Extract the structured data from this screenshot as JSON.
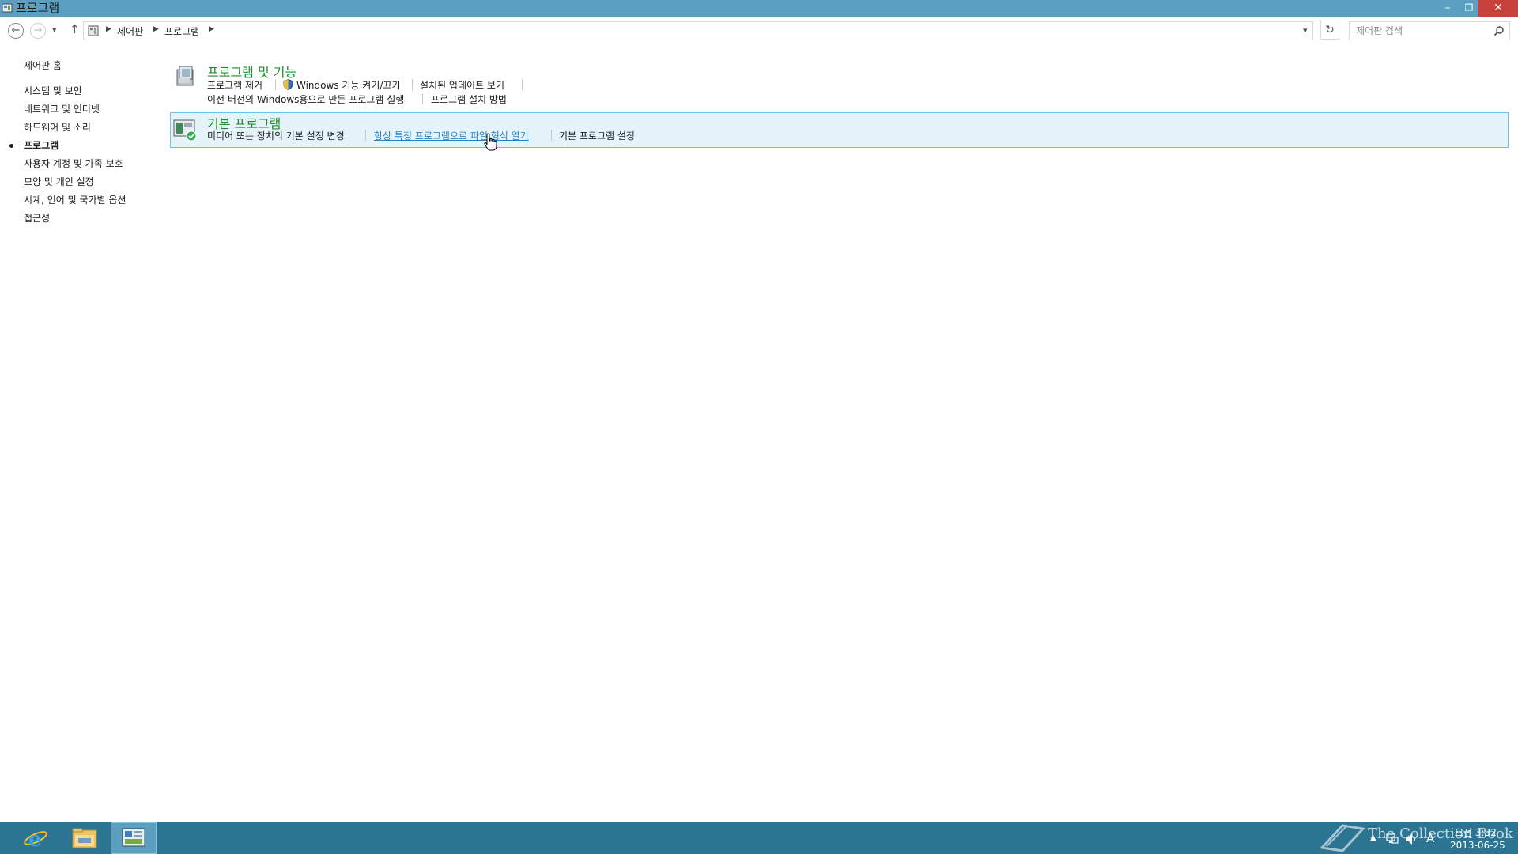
{
  "window": {
    "title": "프로그램"
  },
  "address": {
    "crumbs": [
      "제어판",
      "프로그램"
    ],
    "search_placeholder": "제어판 검색"
  },
  "sidebar": {
    "items": [
      {
        "label": "제어판 홈",
        "active": false
      },
      {
        "label": "시스템 및 보안",
        "active": false
      },
      {
        "label": "네트워크 및 인터넷",
        "active": false
      },
      {
        "label": "하드웨어 및 소리",
        "active": false
      },
      {
        "label": "프로그램",
        "active": true
      },
      {
        "label": "사용자 계정 및 가족 보호",
        "active": false
      },
      {
        "label": "모양 및 개인 설정",
        "active": false
      },
      {
        "label": "시계, 언어 및 국가별 옵션",
        "active": false
      },
      {
        "label": "접근성",
        "active": false
      }
    ]
  },
  "categories": [
    {
      "title": "프로그램 및 기능",
      "tasks": [
        "프로그램 제거",
        "Windows 기능 켜기/끄기",
        "설치된 업데이트 보기",
        "이전 버전의 Windows용으로 만든 프로그램 실행",
        "프로그램 설치 방법"
      ]
    },
    {
      "title": "기본 프로그램",
      "tasks": [
        "미디어 또는 장치의 기본 설정 변경",
        "항상 특정 프로그램으로 파일 형식 열기",
        "기본 프로그램 설정"
      ]
    }
  ],
  "taskbar": {
    "items": [
      "internet-explorer",
      "file-explorer",
      "control-panel"
    ],
    "tray": {
      "time": "오전 3:32",
      "date": "2013-06-25",
      "ime": "A"
    }
  },
  "watermark": {
    "text": "The Collection Book"
  },
  "colors": {
    "titlebar": "#5ba0c0",
    "taskbar": "#2b7592",
    "category_title": "#1e8c2e",
    "link_hover": "#2a7fbd",
    "highlight_bg": "#e5f3fb",
    "highlight_border": "#70c0e7"
  }
}
